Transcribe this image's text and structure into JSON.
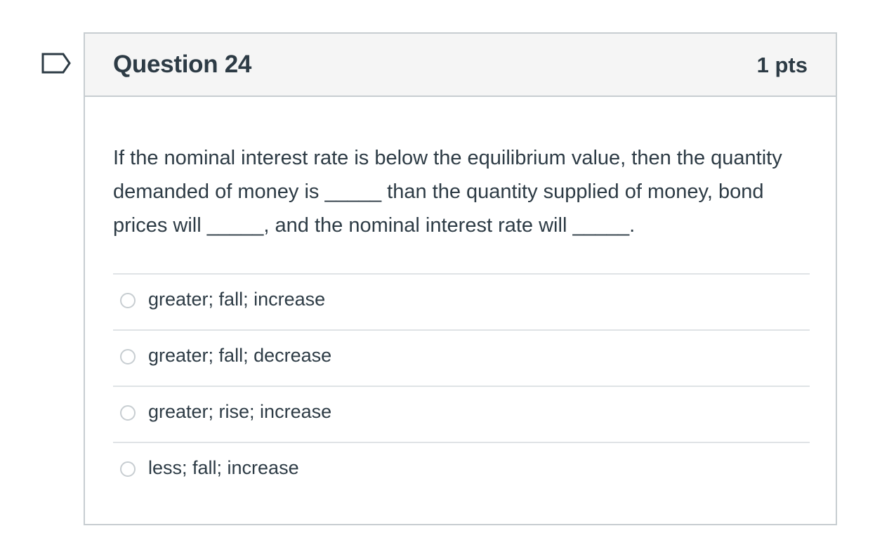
{
  "question": {
    "title": "Question 24",
    "points": "1 pts",
    "text": "If the nominal interest rate is below the equilibrium value, then the quantity demanded of money is _____ than the quantity supplied of money, bond prices will _____, and the nominal interest rate will _____.",
    "flag_icon": "bookmark-flag-icon"
  },
  "answers": [
    {
      "label": "greater; fall; increase",
      "selected": false
    },
    {
      "label": "greater; fall; decrease",
      "selected": false
    },
    {
      "label": "greater; rise; increase",
      "selected": false
    },
    {
      "label": "less; fall; increase",
      "selected": false
    }
  ],
  "colors": {
    "text": "#2d3b45",
    "header_bg": "#f5f5f5",
    "border": "#c7cdd1",
    "flag": "#2d3b45"
  }
}
